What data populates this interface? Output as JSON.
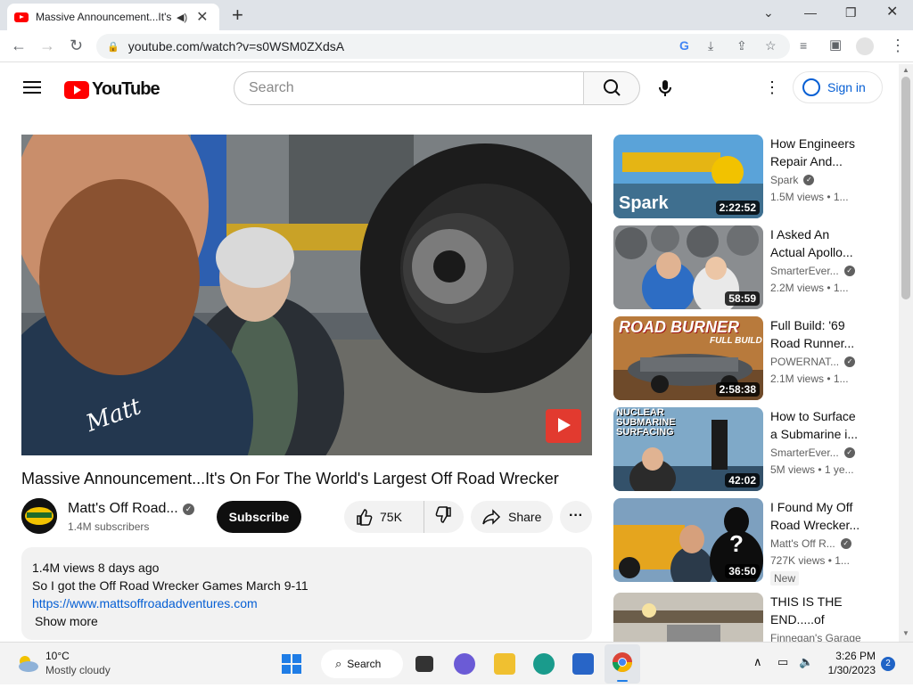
{
  "browser": {
    "tab_title": "Massive Announcement...It's",
    "url": "youtube.com/watch?v=s0WSM0ZXdsA"
  },
  "youtube": {
    "logo_text": "YouTube",
    "search_placeholder": "Search",
    "signin_label": "Sign in"
  },
  "video": {
    "title": "Massive Announcement...It's On For The World's Largest Off Road Wrecker",
    "channel": "Matt's Off Road...",
    "subscribers": "1.4M subscribers",
    "subscribe_label": "Subscribe",
    "likes": "75K",
    "share_label": "Share",
    "views_date": "1.4M views  8 days ago",
    "desc_line": "So I got the Off Road Wrecker Games March 9-11",
    "desc_link": "https://www.mattsoffroadadventures.com",
    "show_more": "Show more",
    "shirt_text": "Matt"
  },
  "recommendations": [
    {
      "title": "How Engineers Repair And...",
      "channel": "Spark",
      "verified": true,
      "views": "1.5M views  •  1...",
      "duration": "2:22:52",
      "thumb_text": "Spark"
    },
    {
      "title": "I Asked An Actual Apollo...",
      "channel": "SmarterEver...",
      "verified": true,
      "views": "2.2M views  •  1...",
      "duration": "58:59",
      "thumb_text": ""
    },
    {
      "title": "Full Build: '69 Road Runner...",
      "channel": "POWERNAT...",
      "verified": true,
      "views": "2.1M views  •  1...",
      "duration": "2:58:38",
      "thumb_text": "ROAD BURNER",
      "thumb_sub": "FULL BUILD"
    },
    {
      "title": "How to Surface a Submarine i...",
      "channel": "SmarterEver...",
      "verified": true,
      "views": "5M views  •  1 ye...",
      "duration": "42:02",
      "thumb_text": "NUCLEAR SUBMARINE SURFACING"
    },
    {
      "title": "I Found My Off Road Wrecker...",
      "channel": "Matt's Off R...",
      "verified": true,
      "views": "727K views  •  1...",
      "duration": "36:50",
      "badge": "New",
      "thumb_text": "?"
    },
    {
      "title": "THIS IS THE END.....of HOT...",
      "channel": "Finnegan's Garage",
      "verified": false,
      "views": "",
      "duration": "",
      "thumb_text": ""
    }
  ],
  "taskbar": {
    "temp": "10°C",
    "weather": "Mostly cloudy",
    "search_label": "Search",
    "time": "3:26 PM",
    "date": "1/30/2023",
    "notif_count": "2"
  },
  "colors": {
    "youtube_red": "#ff0000",
    "link_blue": "#065fd4"
  }
}
